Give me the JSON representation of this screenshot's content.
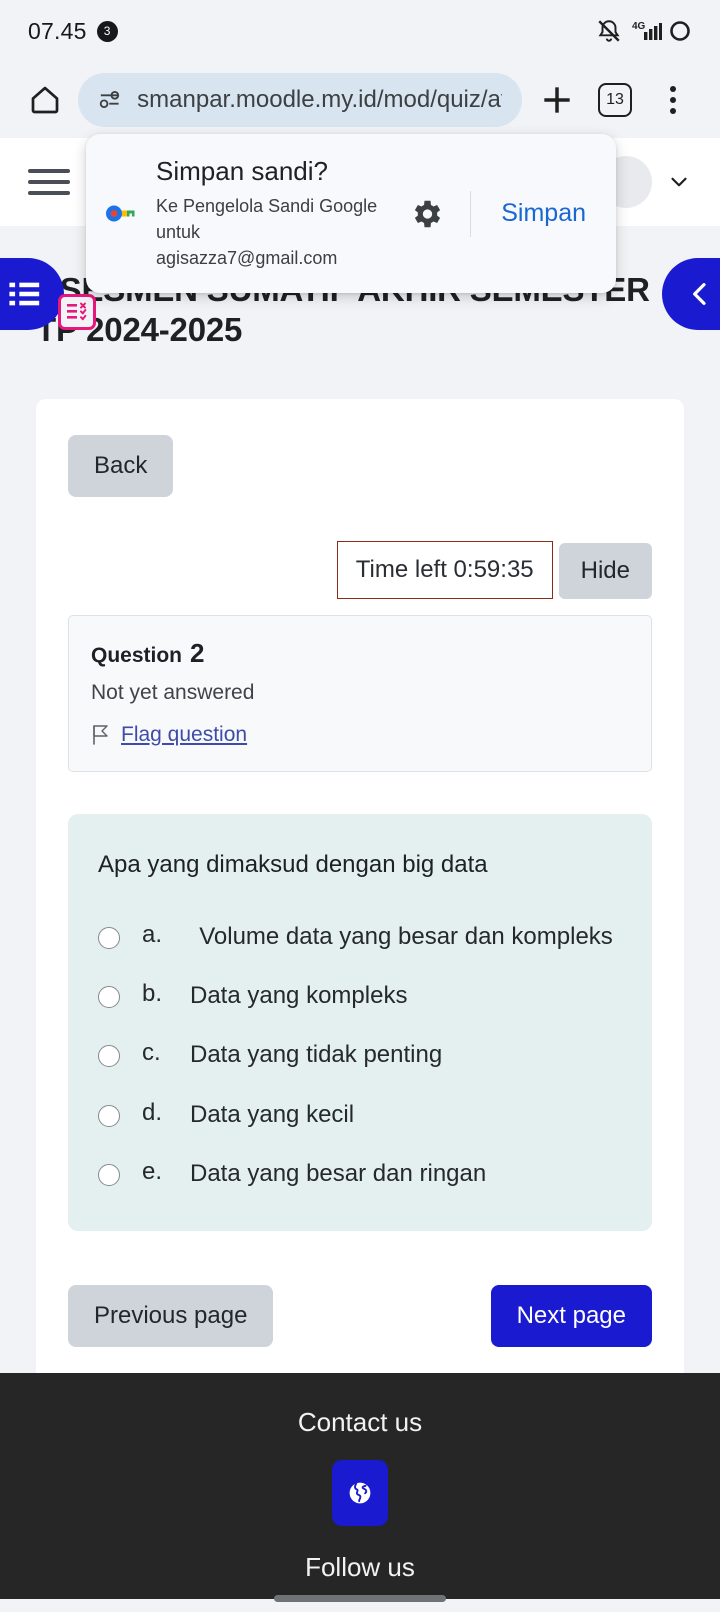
{
  "status_bar": {
    "clock": "07.45",
    "notification_count": "3",
    "icons": [
      "bell-mute-icon",
      "signal-4g-icon",
      "battery-icon"
    ]
  },
  "browser": {
    "home_icon": "home-icon",
    "site_info_icon": "permissions-key-icon",
    "url": "smanpar.moodle.my.id/mod/quiz/atte",
    "new_tab_icon": "plus-icon",
    "tab_count": "13",
    "menu_icon": "kebab-menu-icon"
  },
  "password_dialog": {
    "icon": "google-password-key-icon",
    "title": "Simpan sandi?",
    "subtitle": "Ke Pengelola Sandi Google untuk agisazza7@gmail.com",
    "settings_icon": "gear-icon",
    "save_label": "Simpan"
  },
  "moodle_nav": {
    "menu_icon": "hamburger-menu-icon",
    "avatar_label": "",
    "chevron_icon": "chevron-down-icon"
  },
  "drawers": {
    "left_icon": "course-index-list-icon",
    "quiz_badge_icon": "quiz-navigation-icon",
    "right_icon": "chevron-left-icon"
  },
  "page": {
    "title": "ASESMEN SUMATIF AKHIR SEMESTER TP 2024-2025",
    "back_label": "Back"
  },
  "timer": {
    "label": "Time left 0:59:35",
    "hide_label": "Hide",
    "border_color": "#8c2b18"
  },
  "question_info": {
    "heading_label": "Question",
    "number": "2",
    "state": "Not yet answered",
    "flag_icon": "flag-outline-icon",
    "flag_label": "Flag question"
  },
  "question": {
    "text": "Apa yang dimaksud dengan big data",
    "background_color": "#e4f0ef",
    "options": [
      {
        "letter": "a.",
        "text": "Volume data yang besar dan kompleks",
        "selected": false
      },
      {
        "letter": "b.",
        "text": "Data yang kompleks",
        "selected": false
      },
      {
        "letter": "c.",
        "text": "Data yang tidak penting",
        "selected": false
      },
      {
        "letter": "d.",
        "text": "Data yang kecil",
        "selected": false
      },
      {
        "letter": "e.",
        "text": "Data yang besar dan ringan",
        "selected": false
      }
    ]
  },
  "pagination": {
    "previous_label": "Previous page",
    "next_label": "Next page",
    "next_color": "#1a1ad1"
  },
  "footer": {
    "contact_heading": "Contact us",
    "globe_icon": "globe-icon",
    "follow_heading": "Follow us"
  }
}
